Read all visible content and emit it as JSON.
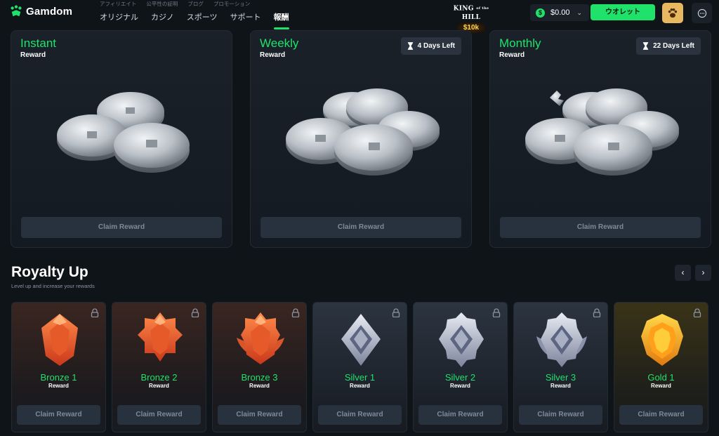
{
  "brand": {
    "name": "Gamdom",
    "accent": "#1fe26b"
  },
  "header": {
    "subnav": [
      "アフィリエイト",
      "公平性の証明",
      "ブログ",
      "プロモーション"
    ],
    "nav": [
      {
        "label": "オリジナル",
        "active": false
      },
      {
        "label": "カジノ",
        "active": false
      },
      {
        "label": "スポーツ",
        "active": false
      },
      {
        "label": "サポート",
        "active": false
      },
      {
        "label": "報酬",
        "active": true
      }
    ],
    "promo": {
      "title_left": "KING",
      "title_mid": "of the",
      "title_right": "HILL",
      "prize": "$10k"
    },
    "balance": {
      "currency_icon": "dollar-icon",
      "amount": "$0.00"
    },
    "wallet_label": "ウオレット",
    "icons": [
      "paw-icon",
      "chat-icon"
    ]
  },
  "rewards": [
    {
      "title": "Instant",
      "subtitle": "Reward",
      "timer": null,
      "claim_label": "Claim Reward"
    },
    {
      "title": "Weekly",
      "subtitle": "Reward",
      "timer": "4 Days Left",
      "claim_label": "Claim Reward"
    },
    {
      "title": "Monthly",
      "subtitle": "Reward",
      "timer": "22 Days Left",
      "claim_label": "Claim Reward"
    }
  ],
  "royalty": {
    "title": "Royalty Up",
    "subtitle": "Level up and increase your rewards",
    "prev_label": "‹",
    "next_label": "›",
    "tiers": [
      {
        "name": "Bronze 1",
        "sub": "Reward",
        "claim_label": "Claim Reward",
        "locked": true
      },
      {
        "name": "Bronze 2",
        "sub": "Reward",
        "claim_label": "Claim Reward",
        "locked": true
      },
      {
        "name": "Bronze 3",
        "sub": "Reward",
        "claim_label": "Claim Reward",
        "locked": true
      },
      {
        "name": "Silver 1",
        "sub": "Reward",
        "claim_label": "Claim Reward",
        "locked": true
      },
      {
        "name": "Silver 2",
        "sub": "Reward",
        "claim_label": "Claim Reward",
        "locked": true
      },
      {
        "name": "Silver 3",
        "sub": "Reward",
        "claim_label": "Claim Reward",
        "locked": true
      },
      {
        "name": "Gold 1",
        "sub": "Reward",
        "claim_label": "Claim Reward",
        "locked": true
      }
    ]
  }
}
